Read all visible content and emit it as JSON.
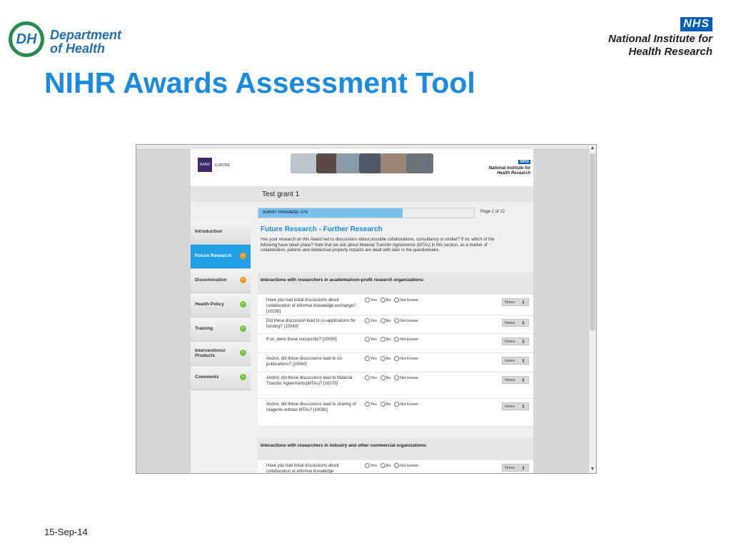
{
  "slide": {
    "logo_left": {
      "mark": "DH",
      "line1": "Department",
      "line2": "of Health"
    },
    "logo_right": {
      "badge": "NHS",
      "line1": "National Institute for",
      "line2": "Health Research"
    },
    "title": "NIHR Awards Assessment Tool",
    "date": "15-Sep-14"
  },
  "site": {
    "rand_logo": "RAND",
    "rand_suffix": "EUROPE",
    "nhs_badge": "NHS",
    "nihr_line1": "National Institute for",
    "nihr_line2": "Health Research",
    "grant_title": "Test grant 1",
    "progress": {
      "label": "SURVEY PROGRESS: 67%",
      "fraction": 0.67,
      "page": "Page 2 of 12"
    },
    "nav": [
      {
        "label": "Introduction",
        "status": "none",
        "active": false
      },
      {
        "label": "Future Research",
        "status": "orange",
        "active": true
      },
      {
        "label": "Dissemination",
        "status": "orange",
        "active": false
      },
      {
        "label": "Health Policy",
        "status": "green",
        "active": false
      },
      {
        "label": "Training",
        "status": "green",
        "active": false
      },
      {
        "label": "Interventions/ Products",
        "status": "green",
        "active": false
      },
      {
        "label": "Comments",
        "status": "green",
        "active": false
      }
    ],
    "section_title": "Future Research - Further Research",
    "intro": "Has your research on this Award led to discussions about possible collaborations, consultancy or similar? If so, which of the following have taken place? Note that we ask about Material Transfer Agreements (MTAs) in this section, as a marker of collaboration, patents and intellectual property impacts are dealt with later in the questionnaire.",
    "options": {
      "yes": "Yes",
      "no": "No",
      "not_known": "Not known"
    },
    "notes_label": "Notes",
    "panels": [
      {
        "heading": "Interactions with researchers in academia/non-profit research organizations:",
        "questions": [
          "Have you had initial discussions about collaboration or informal knowledge exchange? [10030]",
          "Did these discussion lead to co-applications for funding? [10040]",
          "If so, were these successful? [10050]",
          "And/or, did these discussions lead to co-publications? [10060]",
          "And/or, did these discussions lead to Material Transfer Agreements(MTAs)? [10070]",
          "And/or, did these discussions lead to sharing of reagents without MTAs? [10080]"
        ]
      },
      {
        "heading": "Interactions with researchers in industry and other commercial organizations:",
        "questions": [
          "Have you had initial discussions about collaboration or informal knowledge"
        ]
      }
    ]
  }
}
